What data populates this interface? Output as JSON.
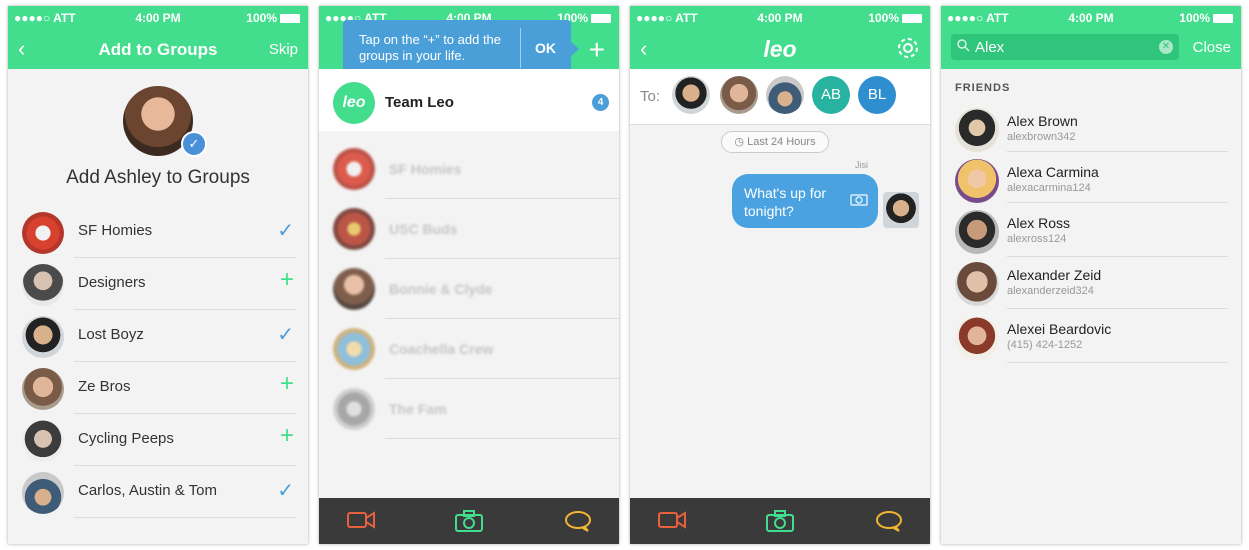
{
  "status": {
    "carrier": "●●●●○ ATT",
    "time": "4:00 PM",
    "battery": "100%"
  },
  "colors": {
    "green": "#43dd8e",
    "blue": "#4a9fd9",
    "dark": "#3a3a3a"
  },
  "screen1": {
    "back_label": "‹",
    "title": "Add to Groups",
    "skip_label": "Skip",
    "heading": "Add Ashley to Groups",
    "groups": [
      {
        "label": "SF Homies",
        "state": "✓"
      },
      {
        "label": "Designers",
        "state": "+"
      },
      {
        "label": "Lost Boyz",
        "state": "✓"
      },
      {
        "label": "Ze Bros",
        "state": "+"
      },
      {
        "label": "Cycling Peeps",
        "state": "+"
      },
      {
        "label": "Carlos, Austin & Tom",
        "state": "✓"
      }
    ]
  },
  "screen2": {
    "tooltip_text": "Tap on the “+” to add the groups in your life.",
    "ok_label": "OK",
    "plus_label": "+",
    "team": {
      "avatar_text": "leo",
      "label": "Team Leo",
      "count": "4"
    },
    "groups": [
      "SF Homies",
      "USC Buds",
      "Bonnie & Clyde",
      "Coachella Crew",
      "The Fam"
    ]
  },
  "screen3": {
    "back_label": "‹",
    "logo": "leo",
    "to_label": "To:",
    "recipients_initials": [
      "AB",
      "BL"
    ],
    "time_filter": "Last 24 Hours",
    "sender": "Jisi",
    "message": "What's up for tonight?"
  },
  "screen4": {
    "search_value": "Alex",
    "close_label": "Close",
    "section": "FRIENDS",
    "friends": [
      {
        "name": "Alex Brown",
        "username": "alexbrown342"
      },
      {
        "name": "Alexa Carmina",
        "username": "alexacarmina124"
      },
      {
        "name": "Alex Ross",
        "username": "alexross124"
      },
      {
        "name": "Alexander Zeid",
        "username": "alexanderzeid324"
      },
      {
        "name": "Alexei Beardovic",
        "username": "(415) 424-1252"
      }
    ]
  }
}
